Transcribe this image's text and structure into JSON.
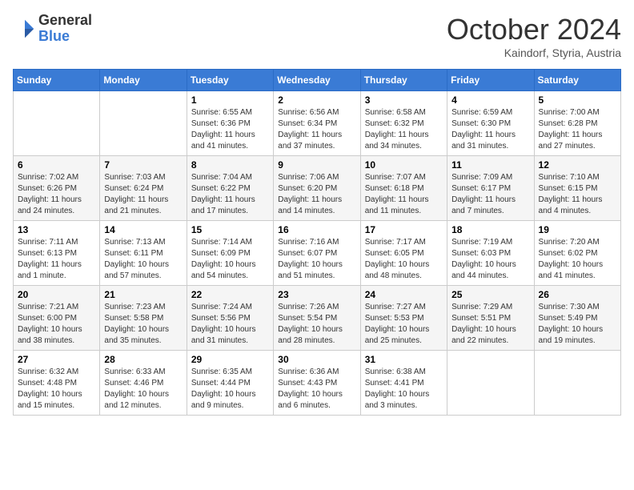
{
  "logo": {
    "general": "General",
    "blue": "Blue"
  },
  "header": {
    "month": "October 2024",
    "location": "Kaindorf, Styria, Austria"
  },
  "weekdays": [
    "Sunday",
    "Monday",
    "Tuesday",
    "Wednesday",
    "Thursday",
    "Friday",
    "Saturday"
  ],
  "weeks": [
    [
      {
        "day": "",
        "info": ""
      },
      {
        "day": "",
        "info": ""
      },
      {
        "day": "1",
        "info": "Sunrise: 6:55 AM\nSunset: 6:36 PM\nDaylight: 11 hours and 41 minutes."
      },
      {
        "day": "2",
        "info": "Sunrise: 6:56 AM\nSunset: 6:34 PM\nDaylight: 11 hours and 37 minutes."
      },
      {
        "day": "3",
        "info": "Sunrise: 6:58 AM\nSunset: 6:32 PM\nDaylight: 11 hours and 34 minutes."
      },
      {
        "day": "4",
        "info": "Sunrise: 6:59 AM\nSunset: 6:30 PM\nDaylight: 11 hours and 31 minutes."
      },
      {
        "day": "5",
        "info": "Sunrise: 7:00 AM\nSunset: 6:28 PM\nDaylight: 11 hours and 27 minutes."
      }
    ],
    [
      {
        "day": "6",
        "info": "Sunrise: 7:02 AM\nSunset: 6:26 PM\nDaylight: 11 hours and 24 minutes."
      },
      {
        "day": "7",
        "info": "Sunrise: 7:03 AM\nSunset: 6:24 PM\nDaylight: 11 hours and 21 minutes."
      },
      {
        "day": "8",
        "info": "Sunrise: 7:04 AM\nSunset: 6:22 PM\nDaylight: 11 hours and 17 minutes."
      },
      {
        "day": "9",
        "info": "Sunrise: 7:06 AM\nSunset: 6:20 PM\nDaylight: 11 hours and 14 minutes."
      },
      {
        "day": "10",
        "info": "Sunrise: 7:07 AM\nSunset: 6:18 PM\nDaylight: 11 hours and 11 minutes."
      },
      {
        "day": "11",
        "info": "Sunrise: 7:09 AM\nSunset: 6:17 PM\nDaylight: 11 hours and 7 minutes."
      },
      {
        "day": "12",
        "info": "Sunrise: 7:10 AM\nSunset: 6:15 PM\nDaylight: 11 hours and 4 minutes."
      }
    ],
    [
      {
        "day": "13",
        "info": "Sunrise: 7:11 AM\nSunset: 6:13 PM\nDaylight: 11 hours and 1 minute."
      },
      {
        "day": "14",
        "info": "Sunrise: 7:13 AM\nSunset: 6:11 PM\nDaylight: 10 hours and 57 minutes."
      },
      {
        "day": "15",
        "info": "Sunrise: 7:14 AM\nSunset: 6:09 PM\nDaylight: 10 hours and 54 minutes."
      },
      {
        "day": "16",
        "info": "Sunrise: 7:16 AM\nSunset: 6:07 PM\nDaylight: 10 hours and 51 minutes."
      },
      {
        "day": "17",
        "info": "Sunrise: 7:17 AM\nSunset: 6:05 PM\nDaylight: 10 hours and 48 minutes."
      },
      {
        "day": "18",
        "info": "Sunrise: 7:19 AM\nSunset: 6:03 PM\nDaylight: 10 hours and 44 minutes."
      },
      {
        "day": "19",
        "info": "Sunrise: 7:20 AM\nSunset: 6:02 PM\nDaylight: 10 hours and 41 minutes."
      }
    ],
    [
      {
        "day": "20",
        "info": "Sunrise: 7:21 AM\nSunset: 6:00 PM\nDaylight: 10 hours and 38 minutes."
      },
      {
        "day": "21",
        "info": "Sunrise: 7:23 AM\nSunset: 5:58 PM\nDaylight: 10 hours and 35 minutes."
      },
      {
        "day": "22",
        "info": "Sunrise: 7:24 AM\nSunset: 5:56 PM\nDaylight: 10 hours and 31 minutes."
      },
      {
        "day": "23",
        "info": "Sunrise: 7:26 AM\nSunset: 5:54 PM\nDaylight: 10 hours and 28 minutes."
      },
      {
        "day": "24",
        "info": "Sunrise: 7:27 AM\nSunset: 5:53 PM\nDaylight: 10 hours and 25 minutes."
      },
      {
        "day": "25",
        "info": "Sunrise: 7:29 AM\nSunset: 5:51 PM\nDaylight: 10 hours and 22 minutes."
      },
      {
        "day": "26",
        "info": "Sunrise: 7:30 AM\nSunset: 5:49 PM\nDaylight: 10 hours and 19 minutes."
      }
    ],
    [
      {
        "day": "27",
        "info": "Sunrise: 6:32 AM\nSunset: 4:48 PM\nDaylight: 10 hours and 15 minutes."
      },
      {
        "day": "28",
        "info": "Sunrise: 6:33 AM\nSunset: 4:46 PM\nDaylight: 10 hours and 12 minutes."
      },
      {
        "day": "29",
        "info": "Sunrise: 6:35 AM\nSunset: 4:44 PM\nDaylight: 10 hours and 9 minutes."
      },
      {
        "day": "30",
        "info": "Sunrise: 6:36 AM\nSunset: 4:43 PM\nDaylight: 10 hours and 6 minutes."
      },
      {
        "day": "31",
        "info": "Sunrise: 6:38 AM\nSunset: 4:41 PM\nDaylight: 10 hours and 3 minutes."
      },
      {
        "day": "",
        "info": ""
      },
      {
        "day": "",
        "info": ""
      }
    ]
  ]
}
